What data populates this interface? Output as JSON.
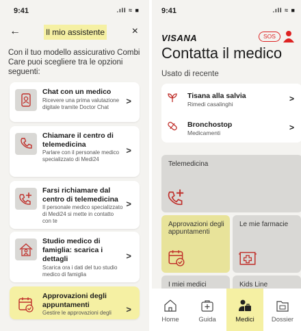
{
  "left": {
    "status_time": "9:41",
    "status_icons": ".ıll ≈ ■",
    "back_glyph": "←",
    "title": "Il mio assistente",
    "close_glyph": "×",
    "intro": "Con il tuo modello assicurativo Combi Care puoi scegliere tra le opzioni seguenti:",
    "cards": [
      {
        "title": "Chat con un medico",
        "desc": "Ricevere una prima valutazione digitale tramite Doctor Chat",
        "icon": "doctor-chat-icon"
      },
      {
        "title": "Chiamare il centro di telemedicina",
        "desc": "Parlare con il personale medico specializzato di Medi24",
        "icon": "phone-icon"
      },
      {
        "title": "Farsi richiamare dal centro di telemedicina",
        "desc": "Il personale medico specializzato di Medi24 si mette in contatto con te",
        "icon": "phone-callback-icon"
      },
      {
        "title": "Studio medico di famiglia: scarica i dettagli",
        "desc": "Scarica ora i dati del tuo studio medico di famiglia",
        "icon": "family-doctor-house-icon"
      },
      {
        "title": "Approvazioni degli appuntamenti",
        "desc": "Gestire le approvazioni degli",
        "icon": "calendar-check-icon"
      }
    ],
    "chevron": ">"
  },
  "right": {
    "status_time": "9:41",
    "status_icons": ".ıll ≈ ■",
    "logo": "VISANA",
    "sos": "SOS",
    "page_title": "Contatta il medico",
    "section": "Usato di recente",
    "recent": [
      {
        "title": "Tisana alla salvia",
        "subtitle": "Rimedi casalinghi",
        "icon": "plant-icon"
      },
      {
        "title": "Bronchostop",
        "subtitle": "Medicamenti",
        "icon": "pill-icon"
      }
    ],
    "chevron": ">",
    "tiles": {
      "telemedicina": "Telemedicina",
      "approvazioni": "Approvazioni degli appuntamenti",
      "farmacie": "Le mie farmacie",
      "medici": "I miei medici",
      "kids": "Kids Line"
    },
    "tabs": [
      {
        "label": "Home",
        "icon": "home-icon"
      },
      {
        "label": "Guida",
        "icon": "first-aid-icon"
      },
      {
        "label": "Medici",
        "icon": "doctor-icon"
      },
      {
        "label": "Dossier",
        "icon": "dossier-icon"
      }
    ],
    "active_tab": "Medici",
    "accent_color": "#f5f0a3",
    "brand_red": "#dd2222"
  }
}
